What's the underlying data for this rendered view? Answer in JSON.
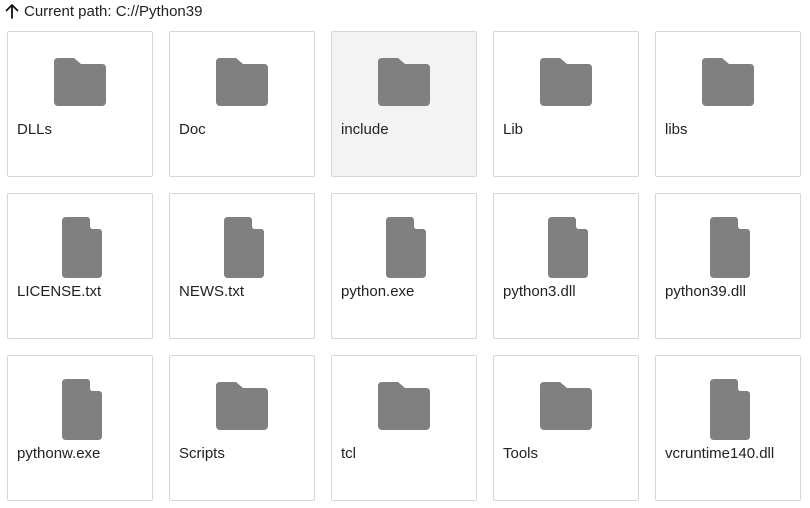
{
  "header": {
    "up_icon": "arrow-up-icon",
    "path_text": "Current path: C://Python39"
  },
  "colors": {
    "icon_fill": "#808080",
    "tile_border": "#d6d6d6",
    "selected_background": "#f3f3f3"
  },
  "items": [
    {
      "name": "DLLs",
      "type": "folder",
      "icon": "folder-icon",
      "selected": false
    },
    {
      "name": "Doc",
      "type": "folder",
      "icon": "folder-icon",
      "selected": false
    },
    {
      "name": "include",
      "type": "folder",
      "icon": "folder-icon",
      "selected": true
    },
    {
      "name": "Lib",
      "type": "folder",
      "icon": "folder-icon",
      "selected": false
    },
    {
      "name": "libs",
      "type": "folder",
      "icon": "folder-icon",
      "selected": false
    },
    {
      "name": "LICENSE.txt",
      "type": "file",
      "icon": "file-icon",
      "selected": false
    },
    {
      "name": "NEWS.txt",
      "type": "file",
      "icon": "file-icon",
      "selected": false
    },
    {
      "name": "python.exe",
      "type": "file",
      "icon": "file-icon",
      "selected": false
    },
    {
      "name": "python3.dll",
      "type": "file",
      "icon": "file-icon",
      "selected": false
    },
    {
      "name": "python39.dll",
      "type": "file",
      "icon": "file-icon",
      "selected": false
    },
    {
      "name": "pythonw.exe",
      "type": "file",
      "icon": "file-icon",
      "selected": false
    },
    {
      "name": "Scripts",
      "type": "folder",
      "icon": "folder-icon",
      "selected": false
    },
    {
      "name": "tcl",
      "type": "folder",
      "icon": "folder-icon",
      "selected": false
    },
    {
      "name": "Tools",
      "type": "folder",
      "icon": "folder-icon",
      "selected": false
    },
    {
      "name": "vcruntime140.dll",
      "type": "file",
      "icon": "file-icon",
      "selected": false
    }
  ]
}
